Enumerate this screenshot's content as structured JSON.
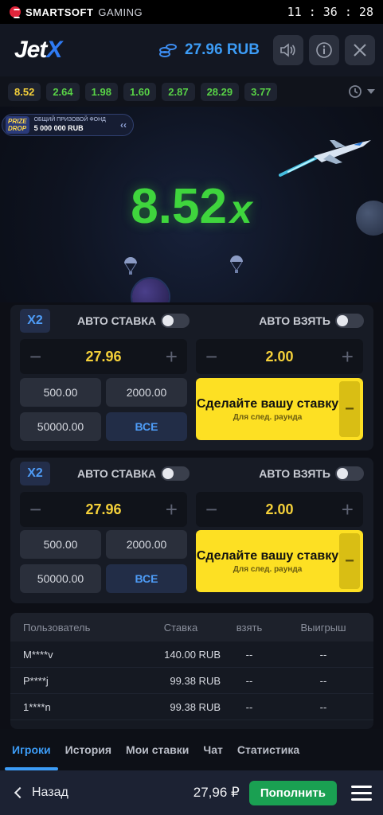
{
  "statusbar": {
    "brand_bold": "SMARTSOFT",
    "brand_light": "GAMING",
    "time": "11 : 36 : 28"
  },
  "header": {
    "logo_main": "Jet",
    "logo_x": "X",
    "balance": "27.96 RUB",
    "icons": [
      "sound-icon",
      "info-icon",
      "close-icon"
    ]
  },
  "multipliers": [
    "8.52",
    "2.64",
    "1.98",
    "1.60",
    "2.87",
    "28.29",
    "3.77"
  ],
  "game": {
    "prize_badge_1": "PRIZE",
    "prize_badge_2": "DROP",
    "prize_line1": "ОБЩИЙ ПРИЗОВОЙ ФОНД",
    "prize_line2": "5 000 000 RUB",
    "multiplier_value": "8.52",
    "multiplier_suffix": "x"
  },
  "panels": [
    {
      "x2": "X2",
      "auto_bet": "АВТО СТАВКА",
      "auto_take": "АВТО ВЗЯТЬ",
      "bet_value": "27.96",
      "cashout_value": "2.00",
      "quick": [
        "500.00",
        "2000.00",
        "50000.00",
        "ВСЕ"
      ],
      "bet_title": "Сделайте вашу ставку",
      "bet_sub": "Для след. раунда"
    },
    {
      "x2": "X2",
      "auto_bet": "АВТО СТАВКА",
      "auto_take": "АВТО ВЗЯТЬ",
      "bet_value": "27.96",
      "cashout_value": "2.00",
      "quick": [
        "500.00",
        "2000.00",
        "50000.00",
        "ВСЕ"
      ],
      "bet_title": "Сделайте вашу ставку",
      "bet_sub": "Для след. раунда"
    }
  ],
  "table": {
    "headers": [
      "Пользователь",
      "Ставка",
      "взять",
      "Выигрыш"
    ],
    "rows": [
      {
        "user": "M****v",
        "bet": "140.00  RUB",
        "take": "--",
        "win": "--"
      },
      {
        "user": "P****j",
        "bet": "99.38  RUB",
        "take": "--",
        "win": "--"
      },
      {
        "user": "1****n",
        "bet": "99.38  RUB",
        "take": "--",
        "win": "--"
      }
    ]
  },
  "tabs": [
    "Игроки",
    "История",
    "Мои ставки",
    "Чат",
    "Статистика"
  ],
  "bottom": {
    "back": "Назад",
    "balance": "27,96 ₽",
    "topup": "Пополнить"
  },
  "colors": {
    "accent": "#3c9cf6",
    "multiplier_green": "#3fd53d",
    "bet_yellow": "#fde023",
    "topup_green": "#1aa052"
  }
}
